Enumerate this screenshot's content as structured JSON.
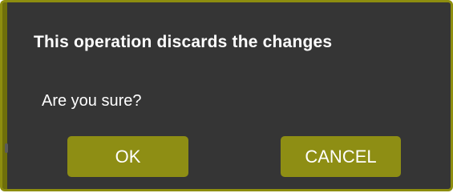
{
  "dialog": {
    "title": "This operation discards the changes",
    "message": "Are you sure?",
    "buttons": {
      "ok_label": "OK",
      "cancel_label": "CANCEL"
    }
  },
  "colors": {
    "dialog_background": "#353535",
    "accent_border": "#8d8d0f",
    "button_background": "#8e8e14",
    "text": "#ffffff"
  }
}
